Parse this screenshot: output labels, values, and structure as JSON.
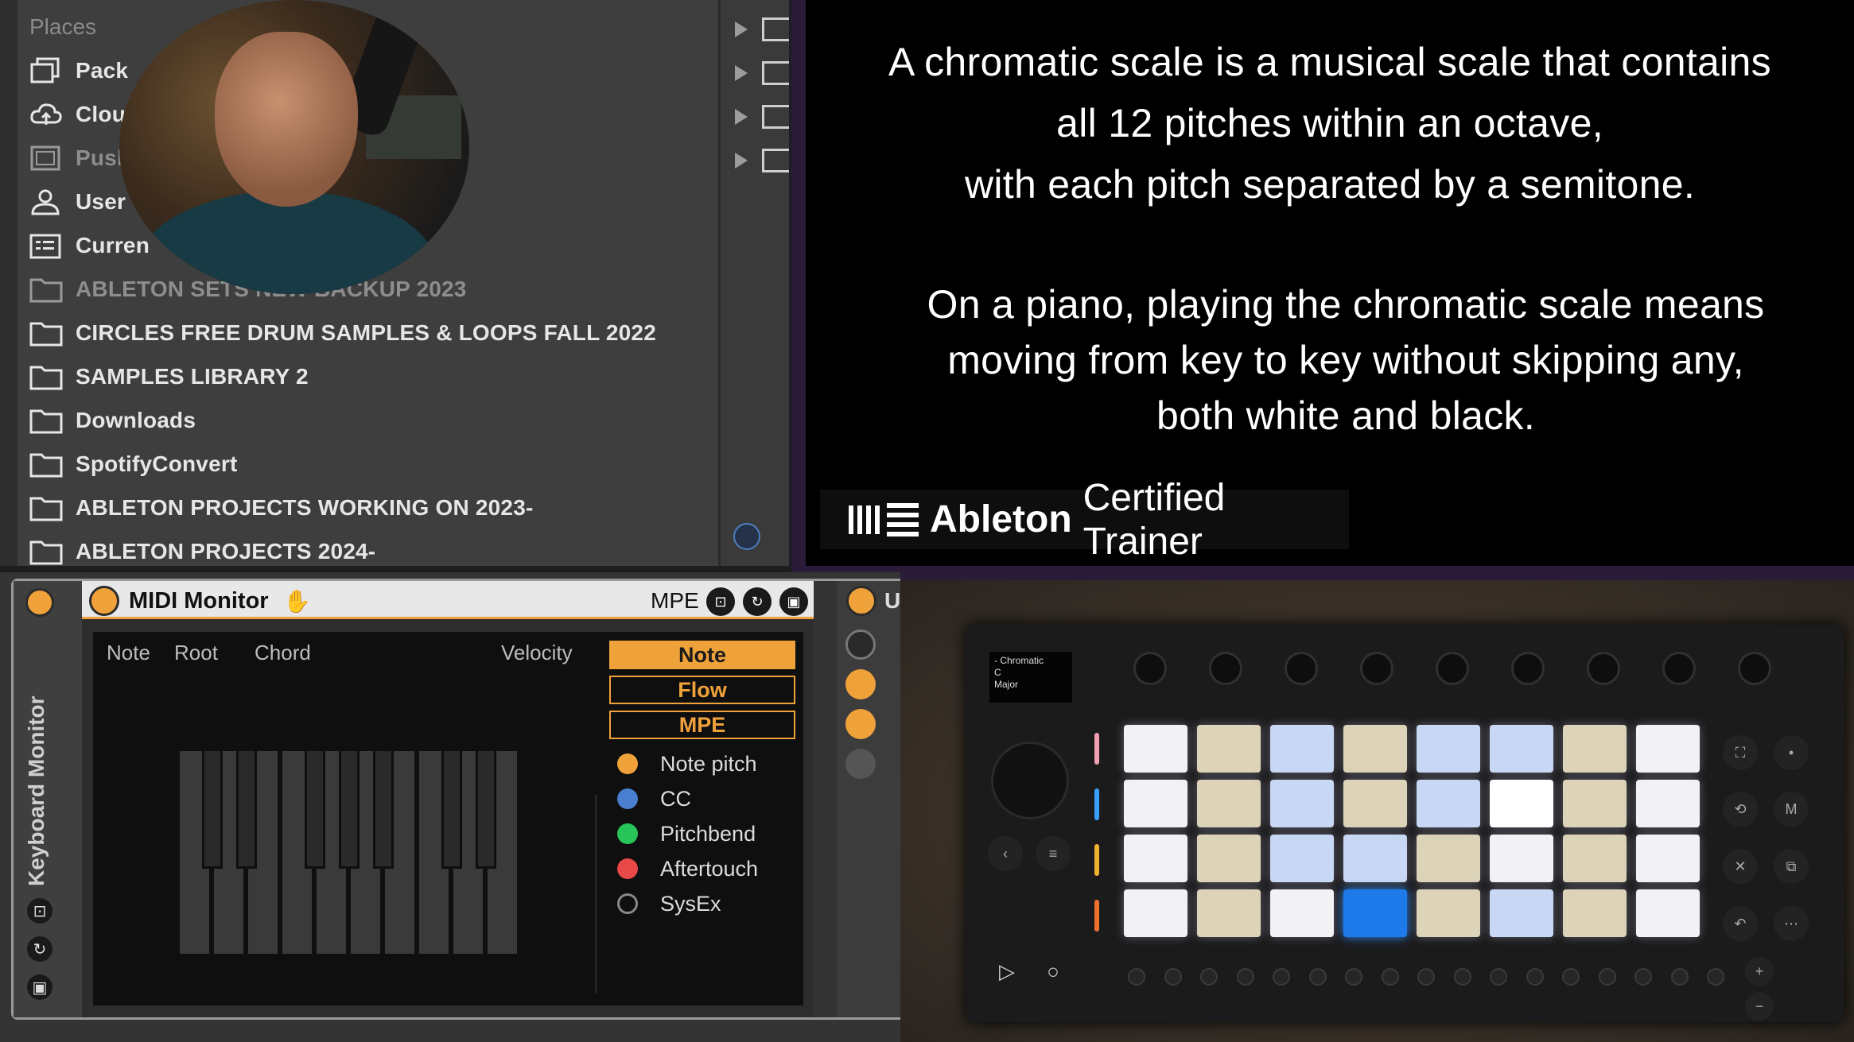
{
  "browser": {
    "places_label": "Places",
    "places": [
      {
        "label": "Pack",
        "icon": "packs-icon",
        "dim": false
      },
      {
        "label": "Clou",
        "icon": "cloud-icon",
        "dim": false
      },
      {
        "label": "Push",
        "icon": "push-icon",
        "dim": true
      },
      {
        "label": "User",
        "icon": "user-icon",
        "dim": false
      },
      {
        "label": "Curren",
        "icon": "current-project-icon",
        "dim": false
      },
      {
        "label": "ABLETON SETS NEW BACKUP 2023",
        "icon": "folder-icon",
        "dim": true
      },
      {
        "label": "CIRCLES FREE DRUM SAMPLES & LOOPS FALL 2022",
        "icon": "folder-icon",
        "dim": false
      },
      {
        "label": "SAMPLES LIBRARY 2",
        "icon": "folder-icon",
        "dim": false
      },
      {
        "label": "Downloads",
        "icon": "folder-icon",
        "dim": false
      },
      {
        "label": "SpotifyConvert",
        "icon": "folder-icon",
        "dim": false
      },
      {
        "label": "ABLETON PROJECTS WORKING ON 2023-",
        "icon": "folder-icon",
        "dim": false
      },
      {
        "label": "ABLETON PROJECTS 2024-",
        "icon": "folder-icon",
        "dim": false
      }
    ]
  },
  "info": {
    "paragraph1": [
      "A chromatic scale is a musical scale that contains",
      "all 12 pitches within an octave,",
      "with each pitch separated by a semitone."
    ],
    "paragraph2": [
      "On a piano, playing the chromatic scale means",
      "moving from key to key without skipping any,",
      "both white and black."
    ],
    "badge_brand": "Ableton",
    "badge_role": "Certified Trainer"
  },
  "rack": {
    "side_title": "Keyboard Monitor"
  },
  "device": {
    "title": "MIDI Monitor",
    "mpe_label": "MPE",
    "columns": [
      "Note",
      "Root",
      "Chord",
      "Velocity"
    ],
    "modes": [
      {
        "label": "Note",
        "active": true
      },
      {
        "label": "Flow",
        "active": false
      },
      {
        "label": "MPE",
        "active": false
      }
    ],
    "legend": [
      {
        "label": "Note pitch",
        "color": "#f0a23a"
      },
      {
        "label": "CC",
        "color": "#4a7fd0"
      },
      {
        "label": "Pitchbend",
        "color": "#27c45a"
      },
      {
        "label": "Aftertouch",
        "color": "#e84848"
      },
      {
        "label": "SysEx",
        "color": "transparent"
      }
    ]
  },
  "device2": {
    "letter": "U"
  },
  "push": {
    "display_lines": [
      "- Chromatic",
      "C",
      "Major"
    ],
    "accent": "#1e7ae8"
  }
}
